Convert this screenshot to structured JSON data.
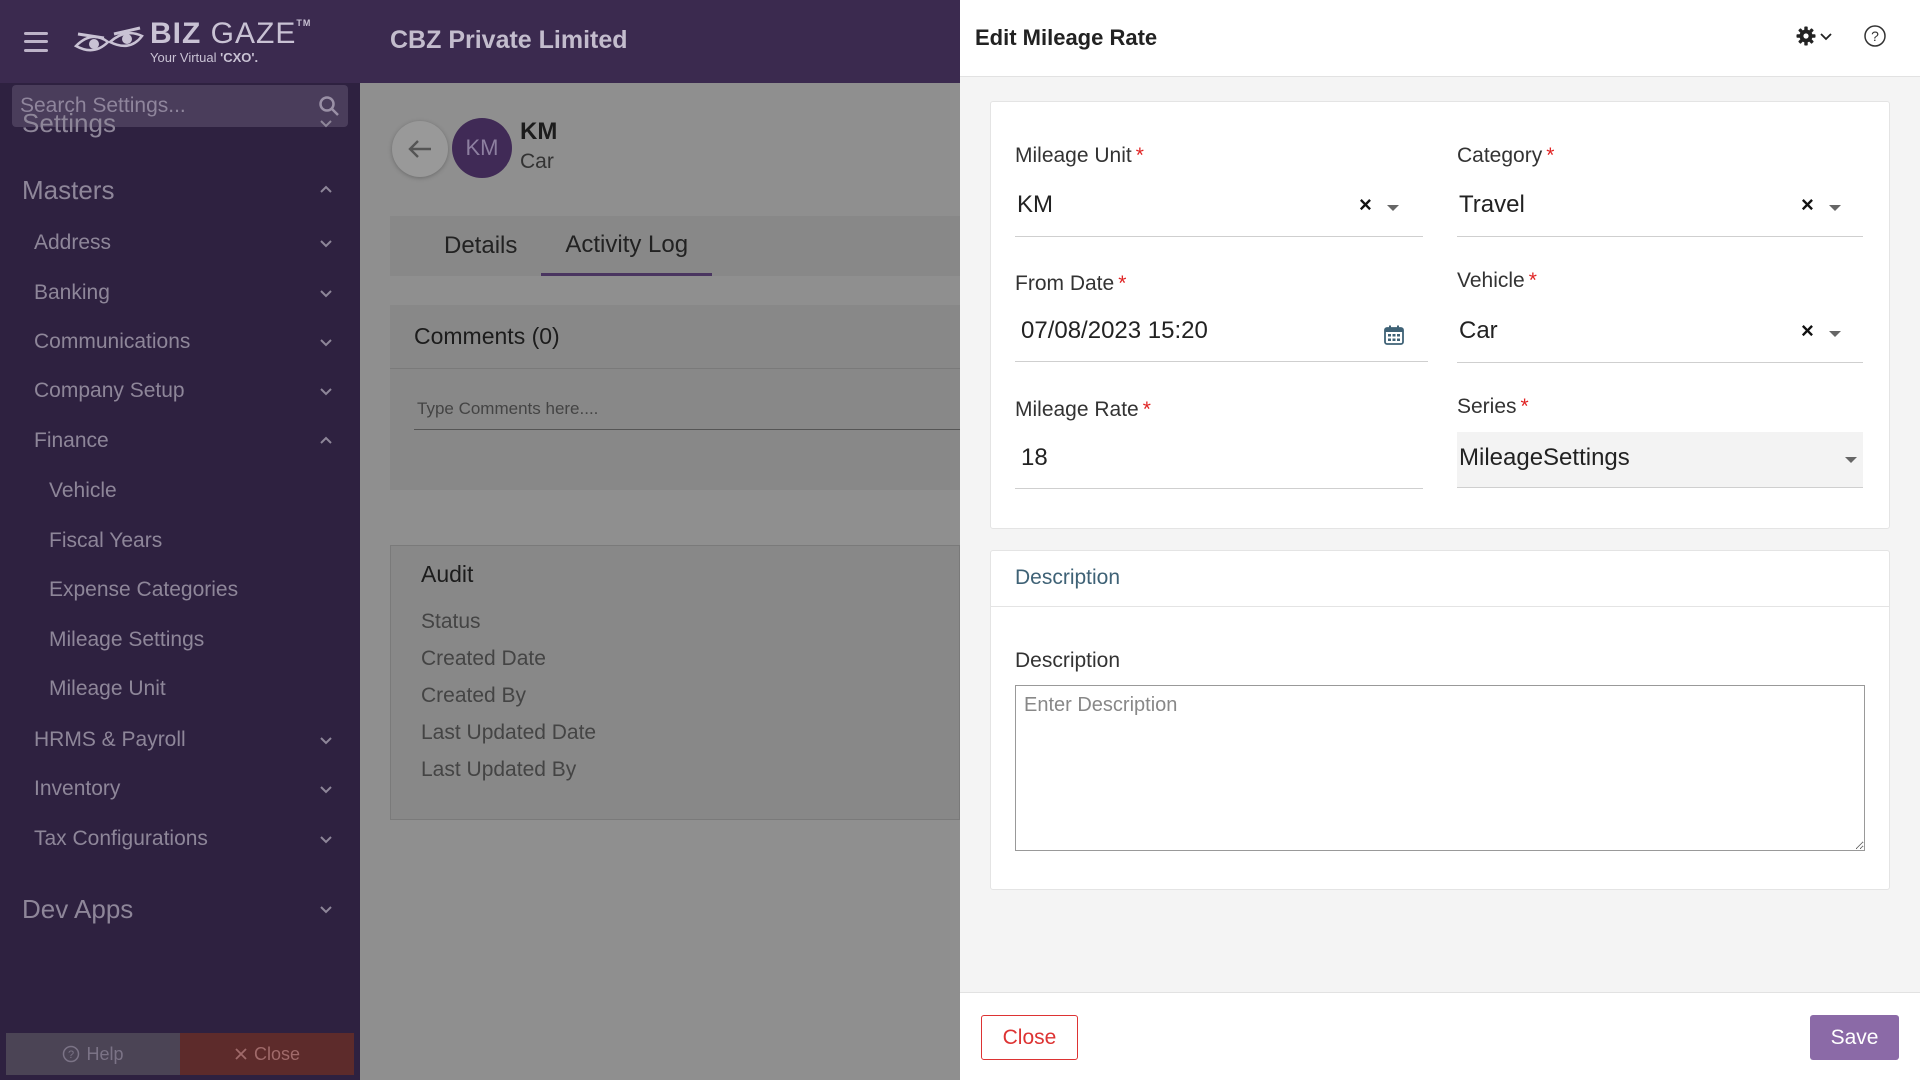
{
  "header": {
    "brand": {
      "name_bold": "BIZ",
      "name_regular": "GAZE",
      "trademark": "TM",
      "tagline_prefix": "Your Virtual ",
      "tagline_bold": "'CXO'."
    },
    "company": "CBZ Private Limited"
  },
  "sidebar": {
    "search_placeholder": "Search Settings...",
    "items": [
      {
        "label": "Settings",
        "level": 0,
        "expanded": false
      },
      {
        "label": "Masters",
        "level": 0,
        "expanded": true
      },
      {
        "label": "Address",
        "level": 1,
        "expanded": false
      },
      {
        "label": "Banking",
        "level": 1,
        "expanded": false
      },
      {
        "label": "Communications",
        "level": 1,
        "expanded": false
      },
      {
        "label": "Company Setup",
        "level": 1,
        "expanded": false
      },
      {
        "label": "Finance",
        "level": 1,
        "expanded": true
      },
      {
        "label": "Vehicle",
        "level": 2
      },
      {
        "label": "Fiscal Years",
        "level": 2
      },
      {
        "label": "Expense Categories",
        "level": 2
      },
      {
        "label": "Mileage Settings",
        "level": 2
      },
      {
        "label": "Mileage Unit",
        "level": 2
      },
      {
        "label": "HRMS & Payroll",
        "level": 1,
        "expanded": false
      },
      {
        "label": "Inventory",
        "level": 1,
        "expanded": false
      },
      {
        "label": "Tax Configurations",
        "level": 1,
        "expanded": false
      },
      {
        "label": "Dev Apps",
        "level": 0,
        "expanded": false
      }
    ],
    "help_label": "Help",
    "close_label": "Close"
  },
  "record": {
    "avatar_initials": "KM",
    "title": "KM",
    "subtitle": "Car",
    "tabs": [
      {
        "label": "Details",
        "active": false
      },
      {
        "label": "Activity Log",
        "active": true
      }
    ],
    "comments_title": "Comments (0)",
    "comments_placeholder": "Type Comments here....",
    "audit_title": "Audit",
    "audit_fields": [
      "Status",
      "Created Date",
      "Created By",
      "Last Updated Date",
      "Last Updated By"
    ]
  },
  "panel": {
    "title": "Edit Mileage Rate",
    "fields": {
      "mileage_unit": {
        "label": "Mileage Unit",
        "value": "KM"
      },
      "category": {
        "label": "Category",
        "value": "Travel"
      },
      "from_date": {
        "label": "From Date",
        "value": "07/08/2023 15:20"
      },
      "vehicle": {
        "label": "Vehicle",
        "value": "Car"
      },
      "mileage_rate": {
        "label": "Mileage Rate",
        "value": "18"
      },
      "series": {
        "label": "Series",
        "value": "MileageSettings"
      }
    },
    "required_mark": "*",
    "clear_symbol": "×",
    "description_section": "Description",
    "description_label": "Description",
    "description_placeholder": "Enter Description",
    "close_label": "Close",
    "save_label": "Save"
  },
  "colors": {
    "header_bg": "#3b2a4f",
    "sidebar_bg": "#2e2140",
    "accent": "#8b6aa7",
    "required": "#e02424",
    "close_red": "#d33333"
  }
}
